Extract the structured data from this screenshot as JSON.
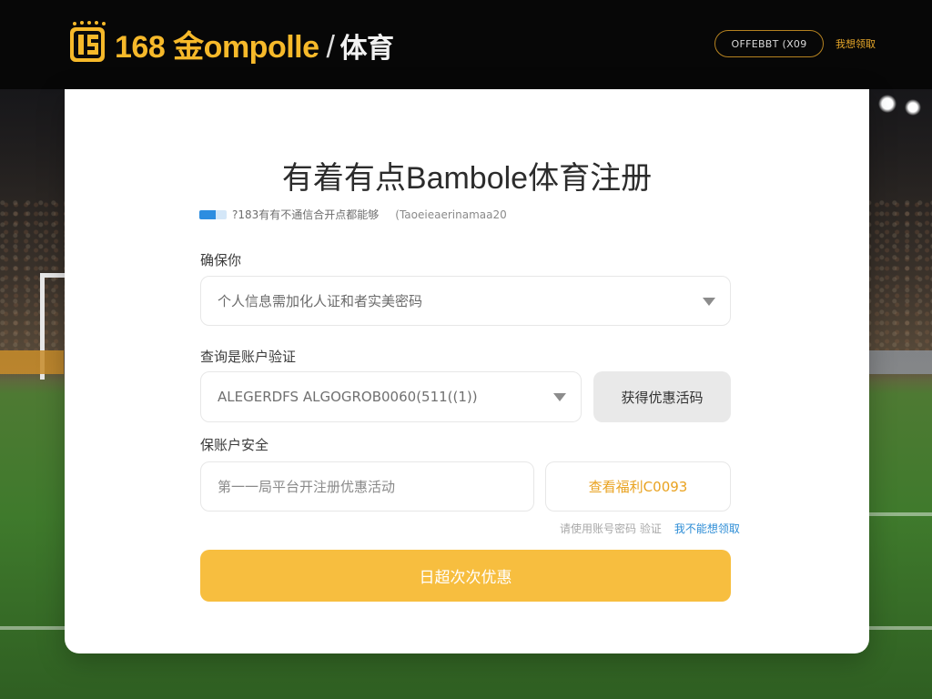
{
  "header": {
    "brand_name": "168 金ompolle",
    "brand_sub": "体育",
    "login_button": "OFFEBBT (X09",
    "register_link": "我想领取"
  },
  "card": {
    "title": "有着有点Bambole体育注册",
    "steps": {
      "text": "?183有有不通信合开点都能够",
      "hint": "(Taoeieaerinamaa20"
    },
    "section1": {
      "label": "确保你",
      "select_placeholder": "个人信息需加化人证和者实美密码"
    },
    "section2": {
      "label": "查询是账户验证",
      "select_value": "ALEGERDFS ALGOGROB0060(511((1))",
      "button": "获得优惠活码"
    },
    "section3": {
      "label": "保账户安全",
      "input_placeholder": "第一一局平台开注册优惠活动",
      "button": "查看福利C0093"
    },
    "help": {
      "text": "请使用账号密码 验证",
      "link": "我不能想领取"
    },
    "submit": "日超次次优惠"
  },
  "colors": {
    "brand_gold": "#f6b92a",
    "submit_yellow": "#f7be3f",
    "link_blue": "#2f8ed6",
    "header_bg": "#070707"
  },
  "icons": [
    "logo-icon",
    "chevron-down-icon"
  ]
}
